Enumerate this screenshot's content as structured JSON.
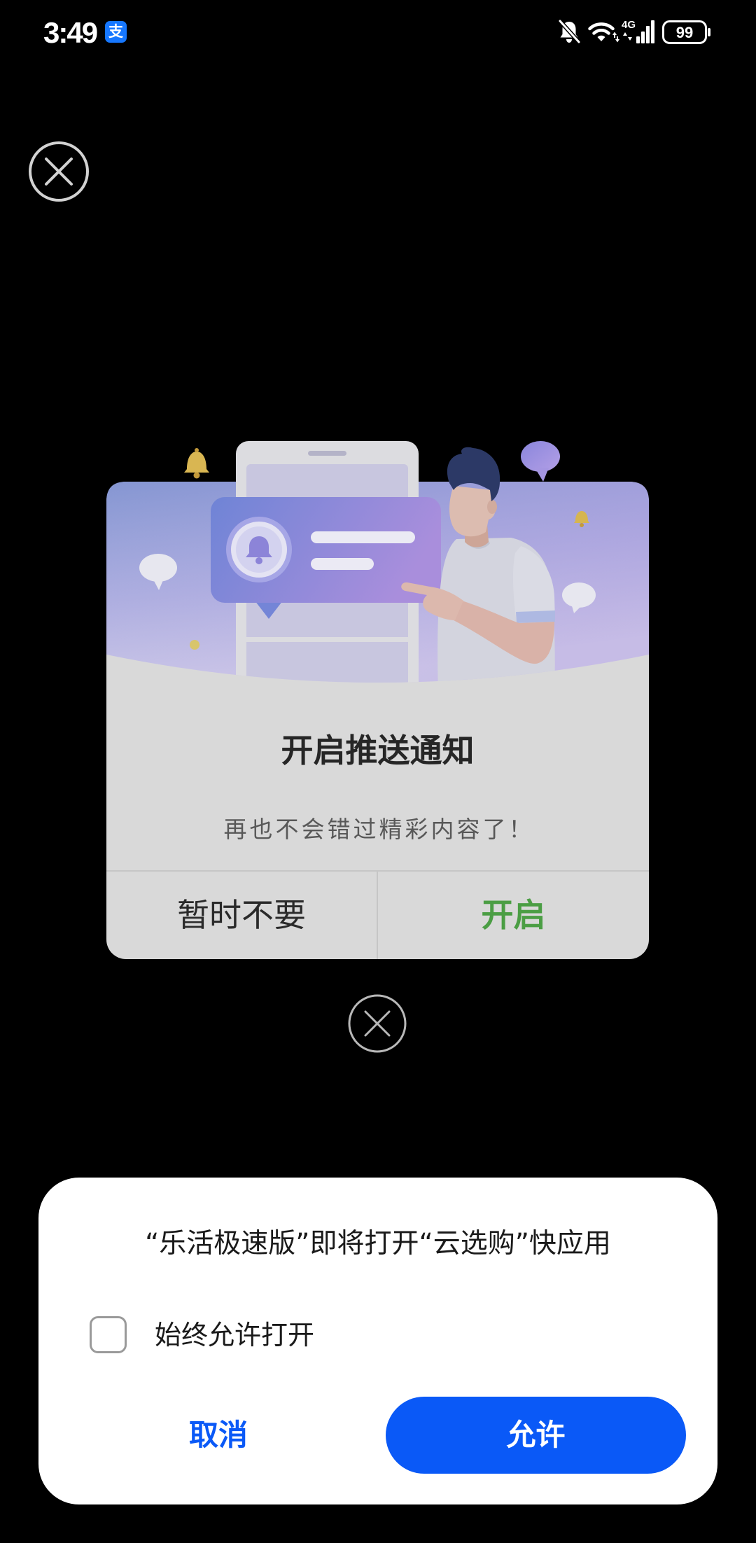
{
  "status_bar": {
    "time": "3:49",
    "app_icon_glyph": "支",
    "app_icon_name": "alipay-icon",
    "app_icon_color": "#1677ff",
    "network": "4G",
    "battery_level": "99",
    "icons": [
      "bell-off-icon",
      "wifi-icon",
      "cellular-signal-icon",
      "battery-icon"
    ]
  },
  "overlay_close": {
    "icon": "close-icon"
  },
  "push_popup": {
    "title": "开启推送通知",
    "subtitle": "再也不会错过精彩内容了！",
    "decline_label": "暂时不要",
    "accept_label": "开启",
    "accept_color": "#4b9e44",
    "close_icon": "close-icon"
  },
  "quick_app_dialog": {
    "message": "“乐活极速版”即将打开“云选购”快应用",
    "always_allow_label": "始终允许打开",
    "always_allow_checked": false,
    "cancel_label": "取消",
    "allow_label": "允许",
    "accent_color": "#0a59f7"
  }
}
